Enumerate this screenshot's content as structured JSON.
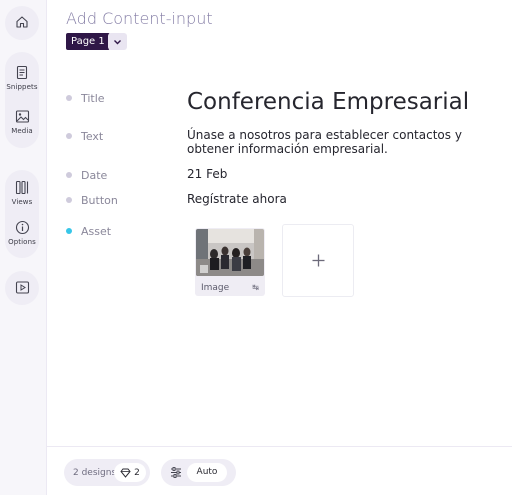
{
  "sidebar": {
    "items": [
      {
        "label": ""
      },
      {
        "label": "Snippets"
      },
      {
        "label": "Media"
      },
      {
        "label": "Views"
      },
      {
        "label": "Options"
      },
      {
        "label": ""
      }
    ]
  },
  "header": {
    "title": "Add Content-input",
    "page_label": "Page 1"
  },
  "fields": [
    {
      "label": "Title",
      "value": "Conferencia Empresarial"
    },
    {
      "label": "Text",
      "value": "Únase a nosotros para establecer contactos y obtener información empresarial."
    },
    {
      "label": "Date",
      "value": "21 Feb"
    },
    {
      "label": "Button",
      "value": "Regístrate ahora"
    },
    {
      "label": "Asset",
      "value": ""
    }
  ],
  "asset": {
    "type_label": "Image",
    "swap_icon": "↹"
  },
  "footer": {
    "designs_text": "2 designs",
    "designs_count": "2",
    "auto_label": "Auto"
  },
  "colors": {
    "accent_dark": "#2f1747",
    "active_dot": "#37c6e8",
    "title_color": "#857ea6"
  }
}
